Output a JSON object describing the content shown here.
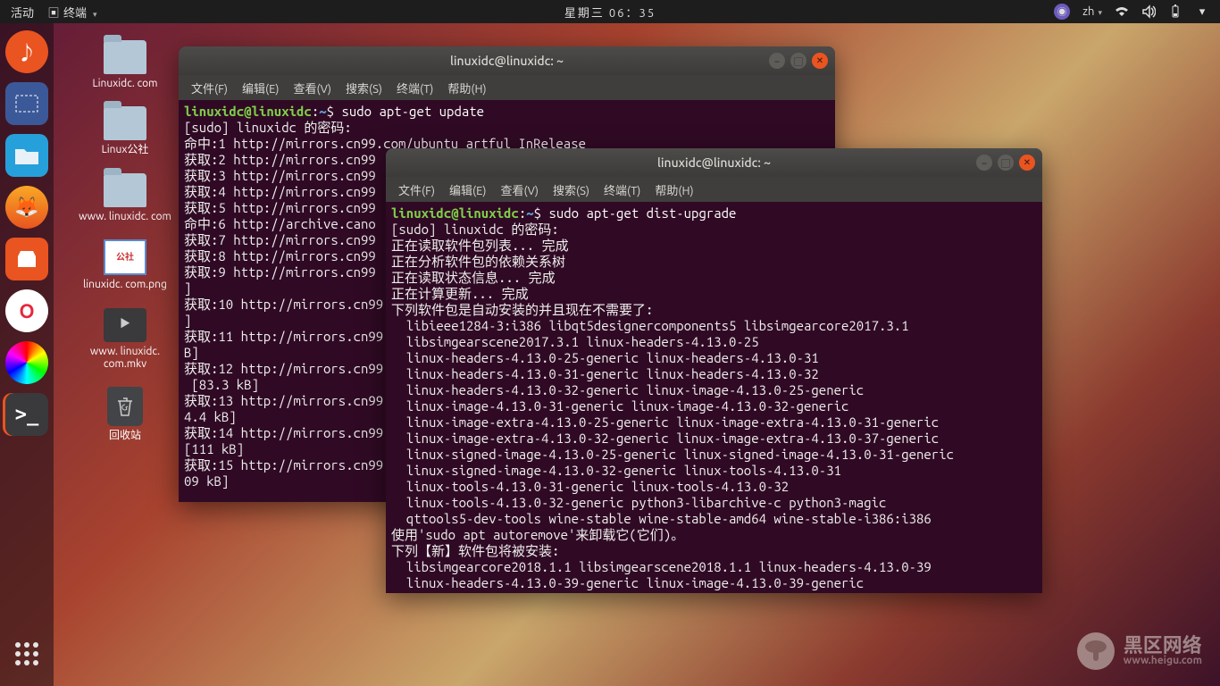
{
  "topbar": {
    "activities": "活动",
    "app_indicator": "终端",
    "clock": "星期三 06：35",
    "ime": "zh"
  },
  "dock": {
    "items": [
      "music",
      "screenshot",
      "files",
      "firefox",
      "software",
      "opera",
      "color",
      "terminal"
    ]
  },
  "desktop": {
    "icons": [
      {
        "type": "folder",
        "label": "Linuxidc.\ncom"
      },
      {
        "type": "folder",
        "label": "Linux公社"
      },
      {
        "type": "folder",
        "label": "www.\nlinuxidc.\ncom"
      },
      {
        "type": "img",
        "label": "linuxidc.\ncom.png",
        "badge": "公社"
      },
      {
        "type": "vid",
        "label": "www.\nlinuxidc.\ncom.mkv"
      },
      {
        "type": "trash",
        "label": "回收站"
      }
    ]
  },
  "menubar": {
    "file": "文件(F)",
    "edit": "编辑(E)",
    "view": "查看(V)",
    "search": "搜索(S)",
    "terminal": "终端(T)",
    "help": "帮助(H)"
  },
  "term_back": {
    "title": "linuxidc@linuxidc: ~",
    "prompt": {
      "user": "linuxidc",
      "host": "linuxidc",
      "path": "~",
      "cmd": "sudo apt-get update"
    },
    "lines": [
      "[sudo] linuxidc 的密码:",
      "命中:1 http://mirrors.cn99.com/ubuntu artful InRelease",
      "获取:2 http://mirrors.cn99",
      "获取:3 http://mirrors.cn99",
      "获取:4 http://mirrors.cn99",
      "获取:5 http://mirrors.cn99",
      "命中:6 http://archive.cano",
      "获取:7 http://mirrors.cn99",
      "获取:8 http://mirrors.cn99",
      "获取:9 http://mirrors.cn99",
      "]",
      "获取:10 http://mirrors.cn99",
      "]",
      "获取:11 http://mirrors.cn99",
      "B]",
      "获取:12 http://mirrors.cn99",
      " [83.3 kB]",
      "获取:13 http://mirrors.cn99",
      "4.4 kB]",
      "获取:14 http://mirrors.cn99",
      "[111 kB]",
      "获取:15 http://mirrors.cn99",
      "09 kB]"
    ]
  },
  "term_front": {
    "title": "linuxidc@linuxidc: ~",
    "prompt": {
      "user": "linuxidc",
      "host": "linuxidc",
      "path": "~",
      "cmd": "sudo apt-get dist-upgrade"
    },
    "lines": [
      "[sudo] linuxidc 的密码:",
      "正在读取软件包列表... 完成",
      "正在分析软件包的依赖关系树",
      "正在读取状态信息... 完成",
      "正在计算更新... 完成",
      "下列软件包是自动安装的并且现在不需要了:",
      "  libieee1284-3:i386 libqt5designercomponents5 libsimgearcore2017.3.1",
      "  libsimgearscene2017.3.1 linux-headers-4.13.0-25",
      "  linux-headers-4.13.0-25-generic linux-headers-4.13.0-31",
      "  linux-headers-4.13.0-31-generic linux-headers-4.13.0-32",
      "  linux-headers-4.13.0-32-generic linux-image-4.13.0-25-generic",
      "  linux-image-4.13.0-31-generic linux-image-4.13.0-32-generic",
      "  linux-image-extra-4.13.0-25-generic linux-image-extra-4.13.0-31-generic",
      "  linux-image-extra-4.13.0-32-generic linux-image-extra-4.13.0-37-generic",
      "  linux-signed-image-4.13.0-25-generic linux-signed-image-4.13.0-31-generic",
      "  linux-signed-image-4.13.0-32-generic linux-tools-4.13.0-31",
      "  linux-tools-4.13.0-31-generic linux-tools-4.13.0-32",
      "  linux-tools-4.13.0-32-generic python3-libarchive-c python3-magic",
      "  qttools5-dev-tools wine-stable wine-stable-amd64 wine-stable-i386:i386",
      "使用'sudo apt autoremove'来卸载它(它们)。",
      "下列【新】软件包将被安装:",
      "  libsimgearcore2018.1.1 libsimgearscene2018.1.1 linux-headers-4.13.0-39",
      "  linux-headers-4.13.0-39-generic linux-image-4.13.0-39-generic"
    ]
  },
  "watermark": {
    "brand": "黑区网络",
    "domain": "www.heigu.com"
  }
}
